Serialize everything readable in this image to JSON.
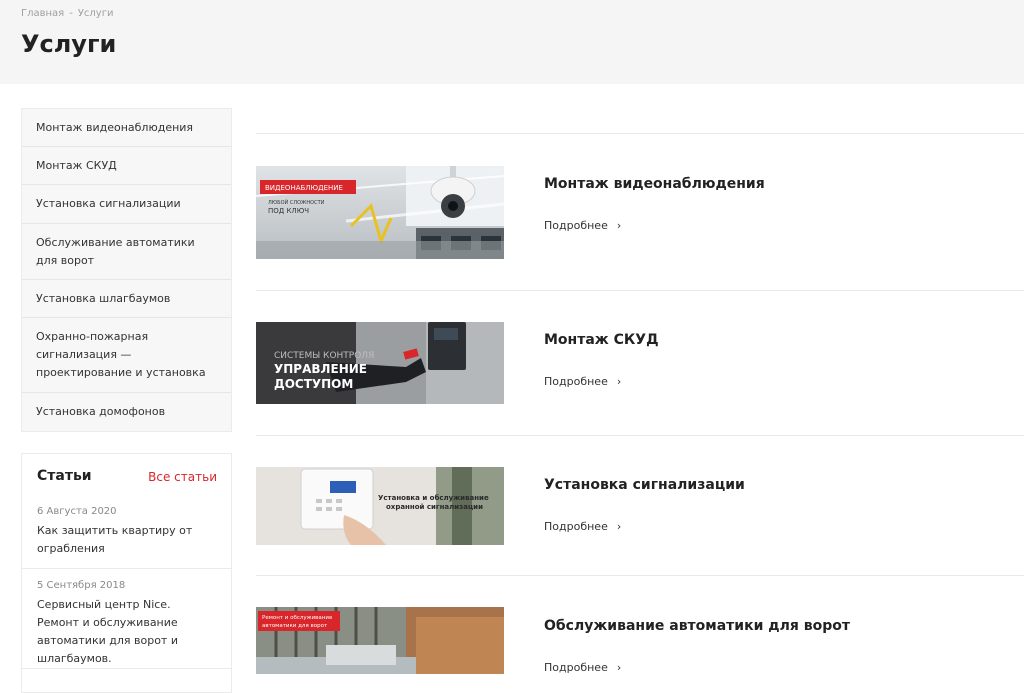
{
  "breadcrumb": {
    "home": "Главная",
    "separator": "-",
    "current": "Услуги"
  },
  "page_title": "Услуги",
  "sidebar": {
    "items": [
      {
        "label": "Монтаж видеонаблюдения"
      },
      {
        "label": "Монтаж СКУД"
      },
      {
        "label": "Установка сигнализации"
      },
      {
        "label": "Обслуживание автоматики для ворот"
      },
      {
        "label": "Установка шлагбаумов"
      },
      {
        "label": "Охранно-пожарная сигнализация — проектирование и установка"
      },
      {
        "label": "Установка домофонов"
      }
    ]
  },
  "articles": {
    "title": "Статьи",
    "all_link": "Все статьи",
    "items": [
      {
        "date": "6 Августа 2020",
        "title": "Как защитить квартиру от ограбления"
      },
      {
        "date": "5 Сентября 2018",
        "title": "Сервисный центр Nice. Ремонт и обслуживание автоматики для ворот и шлагбаумов."
      }
    ]
  },
  "services": [
    {
      "title": "Монтаж видеонаблюдения",
      "more": "Подробнее",
      "banner": {
        "tag": "ВИДЕОНАБЛЮДЕНИЕ",
        "line1": "ЛЮБОЙ СЛОЖНОСТИ",
        "line2": "ПОД КЛЮЧ"
      }
    },
    {
      "title": "Монтаж СКУД",
      "more": "Подробнее",
      "banner": {
        "line1": "СИСТЕМЫ КОНТРОЛЯ",
        "line2": "УПРАВЛЕНИЕ",
        "line3": "ДОСТУПОМ"
      }
    },
    {
      "title": "Установка сигнализации",
      "more": "Подробнее",
      "banner": {
        "line1": "Установка и обслуживание",
        "line2": "охранной сигнализации"
      }
    },
    {
      "title": "Обслуживание автоматики для ворот",
      "more": "Подробнее",
      "banner": {
        "line1": "Ремонт и обслуживание",
        "line2": "автоматики для ворот"
      }
    }
  ],
  "colors": {
    "accent": "#d9262b",
    "header_bg": "#f5f5f5",
    "sidebar_bg": "#f7f7f7"
  },
  "icons": {
    "more_chevron": "chevron-right-icon"
  }
}
